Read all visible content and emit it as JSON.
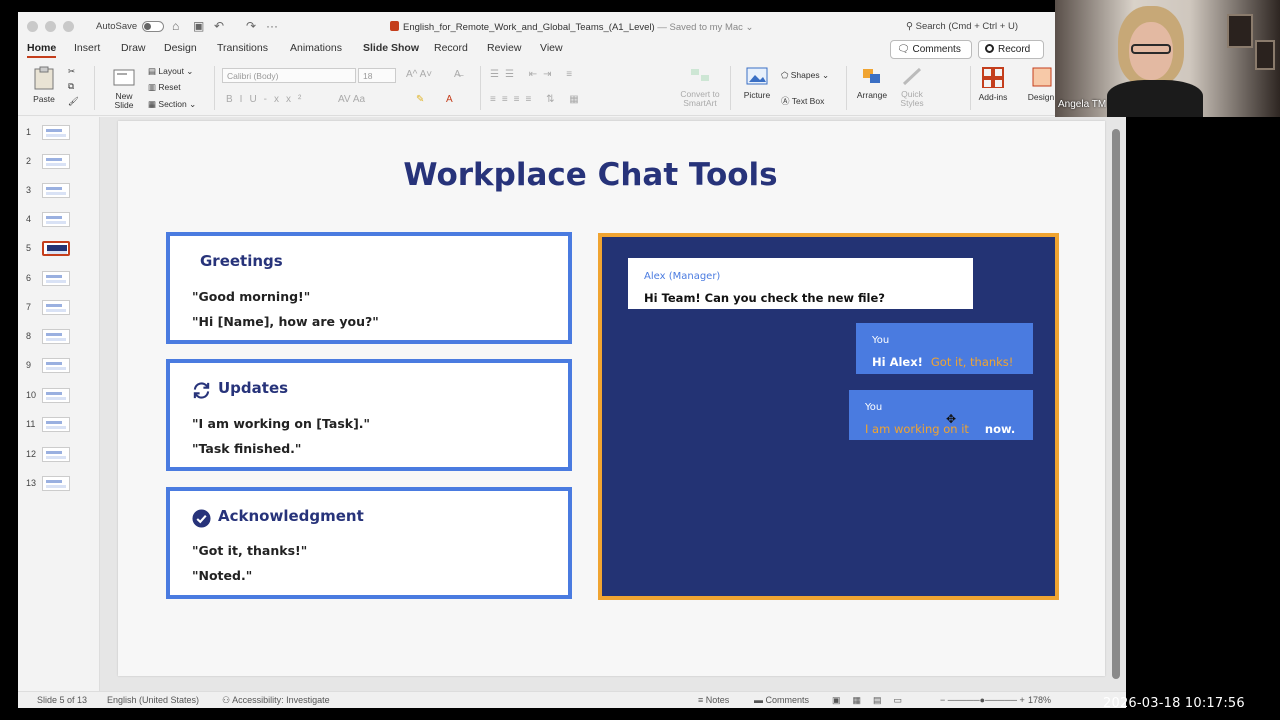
{
  "window": {
    "autosave_label": "AutoSave",
    "doc_name": "English_for_Remote_Work_and_Global_Teams_(A1_Level)",
    "saved_status": "— Saved to my Mac ⌄",
    "search_placeholder": "Search (Cmd + Ctrl + U)"
  },
  "tabs": [
    "Home",
    "Insert",
    "Draw",
    "Design",
    "Transitions",
    "Animations",
    "Slide Show",
    "Record",
    "Review",
    "View"
  ],
  "actions": {
    "comments": "Comments",
    "record": "Record"
  },
  "ribbon": {
    "paste": "Paste",
    "new_slide": "New Slide",
    "layout": "Layout",
    "reset": "Reset",
    "section": "Section",
    "font_name": "Calibri (Body)",
    "font_size": "18",
    "convert": "Convert to SmartArt",
    "picture": "Picture",
    "shapes": "Shapes",
    "text_box": "Text Box",
    "arrange": "Arrange",
    "quick_styles": "Quick Styles",
    "add_ins": "Add-ins",
    "designer": "Design"
  },
  "thumbnails": [
    "1",
    "2",
    "3",
    "4",
    "5",
    "6",
    "7",
    "8",
    "9",
    "10",
    "11",
    "12",
    "13"
  ],
  "selected_slide": 5,
  "slide": {
    "title": "Workplace Chat Tools",
    "cards": [
      {
        "heading": "Greetings",
        "lines": [
          "\"Good morning!\"",
          "\"Hi [Name], how are you?\""
        ],
        "icon": "none"
      },
      {
        "heading": "Updates",
        "lines": [
          "\"I am working on [Task].\"",
          "\"Task finished.\""
        ],
        "icon": "refresh-icon"
      },
      {
        "heading": "Acknowledgment",
        "lines": [
          "\"Got it, thanks!\"",
          "\"Noted.\""
        ],
        "icon": "check-circle-icon"
      }
    ],
    "chat": {
      "manager_name": "Alex (Manager)",
      "manager_text": "Hi Team! Can you check the new file?",
      "reply1_name": "You",
      "reply1_text": "Hi Alex!",
      "reply1_highlight": "Got it, thanks!",
      "reply2_name": "You",
      "reply2_highlight": "I am working on it",
      "reply2_text": "now."
    }
  },
  "status": {
    "slide_count": "Slide 5 of 13",
    "language": "English (United States)",
    "accessibility": "Accessibility: Investigate",
    "notes": "Notes",
    "comments": "Comments",
    "zoom": "178%"
  },
  "webcam": {
    "name": "Angela TM"
  },
  "clock": "2026-03-18  10:17:56",
  "colors": {
    "title_navy": "#27337a",
    "card_border": "#4a7be0",
    "chat_bg": "#233374",
    "chat_border": "#f0a431",
    "accent_red": "#c43e1c"
  }
}
